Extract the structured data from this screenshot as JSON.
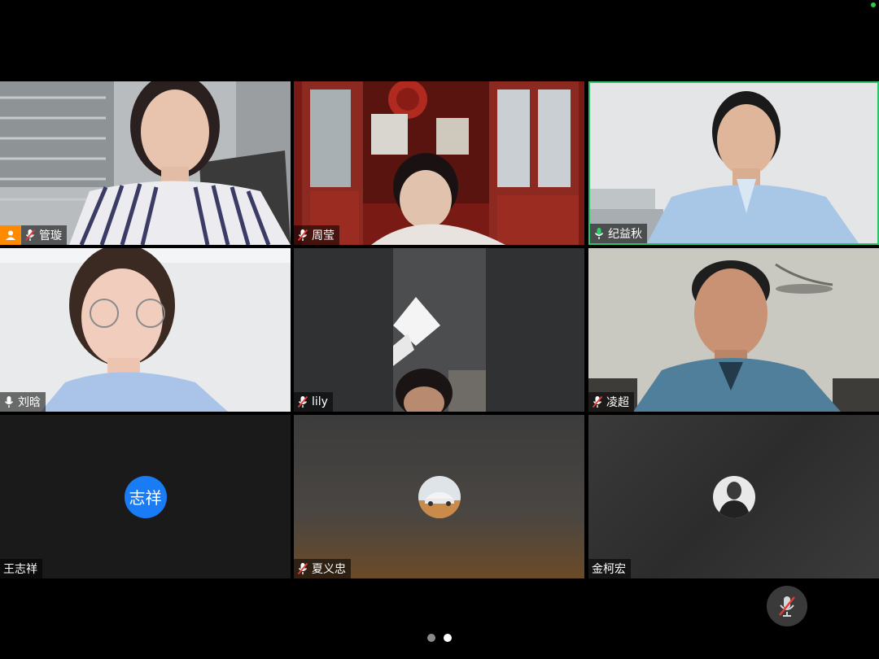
{
  "participants": [
    {
      "name": "管璇",
      "is_host": true,
      "mic": "muted",
      "video": "on"
    },
    {
      "name": "周莹",
      "is_host": false,
      "mic": "muted",
      "video": "on"
    },
    {
      "name": "纪益秋",
      "is_host": false,
      "mic": "on",
      "video": "on",
      "active_speaker": true
    },
    {
      "name": "刘晗",
      "is_host": false,
      "mic": "on",
      "video": "on"
    },
    {
      "name": "lily",
      "is_host": false,
      "mic": "muted",
      "video": "on"
    },
    {
      "name": "凌超",
      "is_host": false,
      "mic": "muted",
      "video": "on"
    },
    {
      "name": "王志祥",
      "is_host": false,
      "mic": "none",
      "video": "off",
      "avatar_text": "志祥"
    },
    {
      "name": "夏义忠",
      "is_host": false,
      "mic": "muted",
      "video": "off",
      "avatar": "car-photo"
    },
    {
      "name": "金柯宏",
      "is_host": false,
      "mic": "none",
      "video": "off",
      "avatar": "person-photo"
    }
  ],
  "controls": {
    "self_mic": "muted"
  },
  "pagination": {
    "total": 2,
    "current": 2
  },
  "colors": {
    "active_border": "#2bc46a",
    "host_badge": "#ff8a00",
    "avatar_blue": "#1a7cf5",
    "mute_red": "#e53935"
  }
}
